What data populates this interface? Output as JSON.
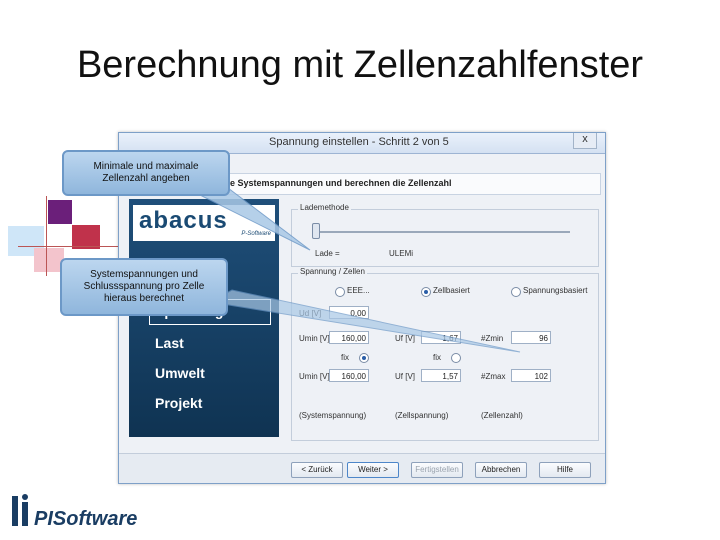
{
  "slide": {
    "title": "Berechnung mit Zellenzahlfenster"
  },
  "dialog": {
    "title": "Spannung einstellen - Schritt 2 von 5",
    "close_label": "x",
    "subtitle": "e Systemspannungen und berechnen die Zellenzahl",
    "logo": "abacus",
    "logo_sub": "P-Software",
    "nav": [
      "Spannung",
      "Last",
      "Umwelt",
      "Projekt"
    ],
    "ladeMethode": {
      "legend": "Lademethode",
      "lade_label": "Lade =",
      "ulem_label": "ULEMi"
    },
    "zellen": {
      "legend": "Spannung / Zellen",
      "radio_eee": "EEE...",
      "radio_zellbasiert": "Zellbasiert",
      "radio_spannungsbasiert": "Spannungsbasiert",
      "ud_label": "Ud [V]",
      "ud_value": "0,00",
      "umin_label": "Umin [V]",
      "umin_value": "160,00",
      "uf_label1": "Uf [V]",
      "uf_value1": "1,67",
      "zmin_label": "#Zmin",
      "zmin_value": "96",
      "fix_label": "fix",
      "umax_label": "Umin [V]",
      "umax_value": "160,00",
      "uf_label2": "Uf [V]",
      "uf_value2": "1,57",
      "zmax_label": "#Zmax",
      "zmax_value": "102",
      "col1": "(Systemspannung)",
      "col2": "(Zellspannung)",
      "col3": "(Zellenzahl)"
    },
    "buttons": {
      "back": "< Zurück",
      "next": "Weiter >",
      "finish": "Fertigstellen",
      "cancel": "Abbrechen",
      "help": "Hilfe"
    }
  },
  "callouts": {
    "first": [
      "Minimale und maximale",
      "Zellenzahl angeben"
    ],
    "second": [
      "Systemspannungen und",
      "Schlussspannung pro Zelle",
      "hieraus berechnet"
    ]
  },
  "brand": "PISoftware"
}
